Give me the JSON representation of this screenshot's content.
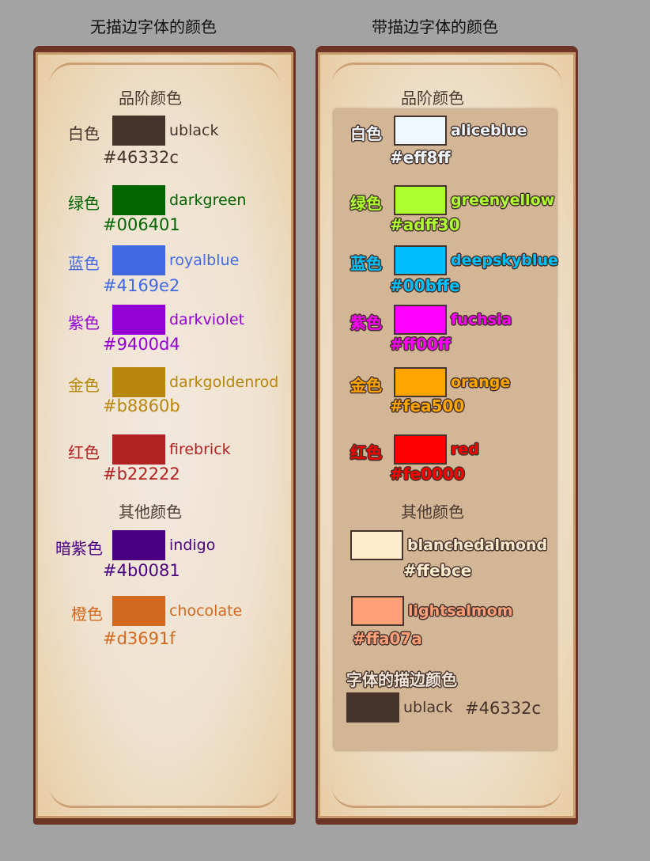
{
  "titles": {
    "left": "无描边字体的颜色",
    "right": "带描边字体的颜色"
  },
  "headings": {
    "quality": "品阶颜色",
    "other": "其他颜色",
    "stroke": "字体的描边颜色"
  },
  "left_quality": [
    {
      "label": "白色",
      "name": "ublack",
      "hex": "#46332c"
    },
    {
      "label": "绿色",
      "name": "darkgreen",
      "hex": "#006401"
    },
    {
      "label": "蓝色",
      "name": "royalblue",
      "hex": "#4169e2"
    },
    {
      "label": "紫色",
      "name": "darkviolet",
      "hex": "#9400d4"
    },
    {
      "label": "金色",
      "name": "darkgoldenrod",
      "hex": "#b8860b"
    },
    {
      "label": "红色",
      "name": "firebrick",
      "hex": "#b22222"
    }
  ],
  "left_other": [
    {
      "label": "暗紫色",
      "name": "indigo",
      "hex": "#4b0081"
    },
    {
      "label": "橙色",
      "name": "chocolate",
      "hex": "#d3691f"
    }
  ],
  "right_quality": [
    {
      "label": "白色",
      "name": "aliceblue",
      "hex": "#eff8ff"
    },
    {
      "label": "绿色",
      "name": "greenyellow",
      "hex": "#adff30"
    },
    {
      "label": "蓝色",
      "name": "deepskyblue",
      "hex": "#00bffe"
    },
    {
      "label": "紫色",
      "name": "fuchsia",
      "hex": "#ff00ff"
    },
    {
      "label": "金色",
      "name": "orange",
      "hex": "#fea500"
    },
    {
      "label": "红色",
      "name": "red",
      "hex": "#fe0000"
    }
  ],
  "right_other": [
    {
      "name": "blanchedalmond",
      "hex": "#ffebce"
    },
    {
      "name": "lightsalmom",
      "hex": "#ffa07a"
    }
  ],
  "stroke_color": {
    "name": "ublack",
    "hex": "#46332c"
  }
}
